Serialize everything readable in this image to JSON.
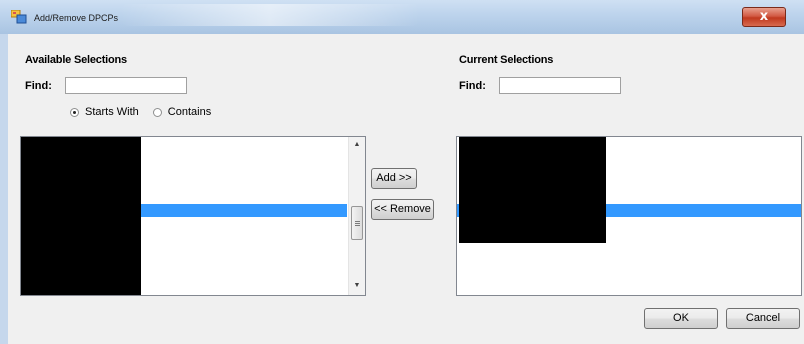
{
  "window": {
    "title": "Add/Remove DPCPs",
    "close_glyph": "x"
  },
  "available": {
    "heading": "Available Selections",
    "find_label": "Find:",
    "find_value": "",
    "radio_starts_with": "Starts With",
    "radio_contains": "Contains",
    "match_mode_selected": "Starts With"
  },
  "current": {
    "heading": "Current Selections",
    "find_label": "Find:",
    "find_value": ""
  },
  "buttons": {
    "add": "Add >>",
    "remove": "<< Remove",
    "ok": "OK",
    "cancel": "Cancel"
  },
  "colors": {
    "selection_highlight": "#3399ff",
    "redacted_block": "#000000"
  },
  "icons": {
    "app_icon": "window-app-icon",
    "close": "close-icon",
    "scroll_up": "scroll-up-arrow-icon",
    "scroll_down": "scroll-down-arrow-icon"
  }
}
